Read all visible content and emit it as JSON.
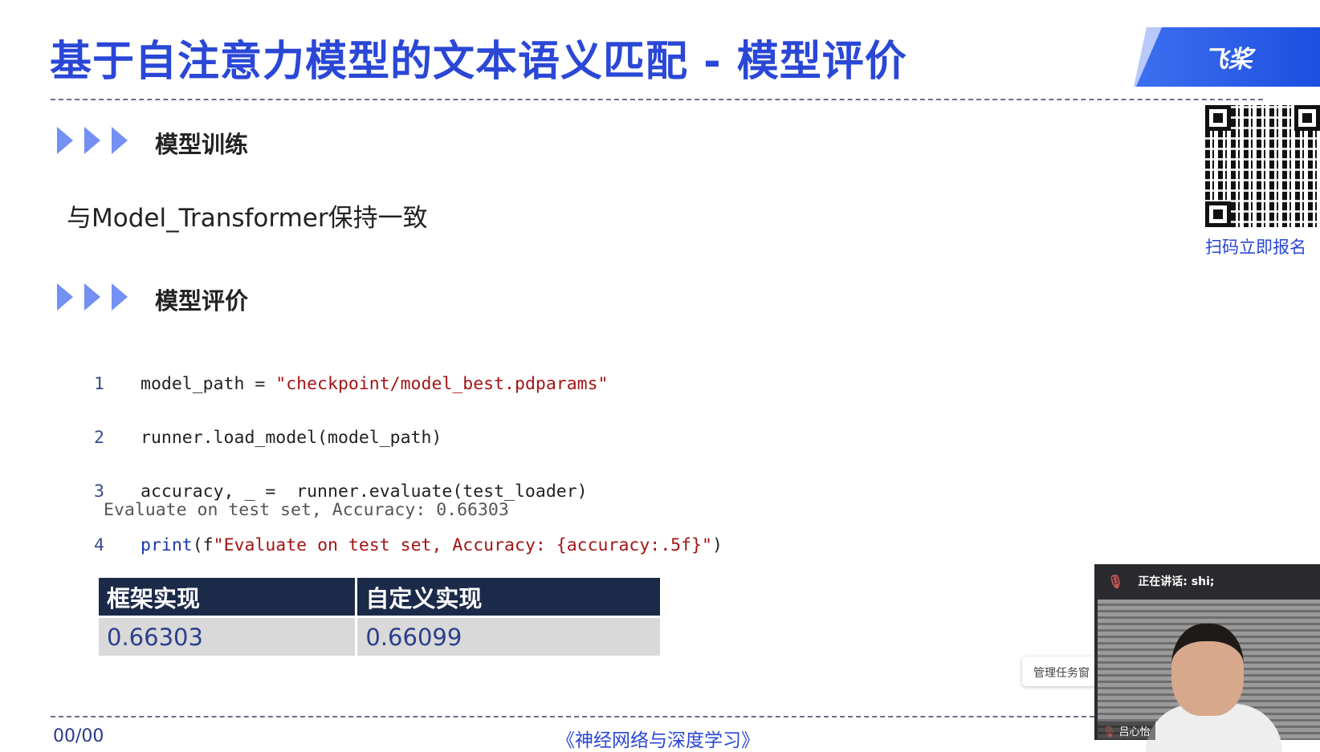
{
  "slide": {
    "title": "基于自注意力模型的文本语义匹配 - 模型评价",
    "logo_text": "飞桨",
    "qr_caption": "扫码立即报名",
    "sections": [
      {
        "heading": "模型训练",
        "body": "与Model_Transformer保持一致"
      },
      {
        "heading": "模型评价"
      }
    ],
    "code": {
      "line_numbers": [
        "1",
        "2",
        "3",
        "4"
      ],
      "line1_a": "model_path = ",
      "line1_str": "\"checkpoint/model_best.pdparams\"",
      "line2": "runner.load_model(model_path)",
      "line3": "accuracy, _ =  runner.evaluate(test_loader)",
      "line4_kw": "print",
      "line4_a": "(f",
      "line4_str": "\"Evaluate on test set, Accuracy: {accuracy:.5f}\"",
      "line4_b": ")"
    },
    "output": "Evaluate on test set, Accuracy: 0.66303",
    "table": {
      "headers": [
        "框架实现",
        "自定义实现"
      ],
      "row": [
        "0.66303",
        "0.66099"
      ]
    },
    "footer": {
      "page": "00/00",
      "book": "《神经网络与深度学习》"
    }
  },
  "meeting": {
    "speaking_label": "正在讲话: shi;",
    "participant_name": "吕心怡",
    "tooltip": "管理任务窗"
  },
  "colors": {
    "title": "#2a47d6",
    "table_header": "#1c2a4a",
    "table_cell": "#d9d9d9",
    "string": "#a31515"
  }
}
